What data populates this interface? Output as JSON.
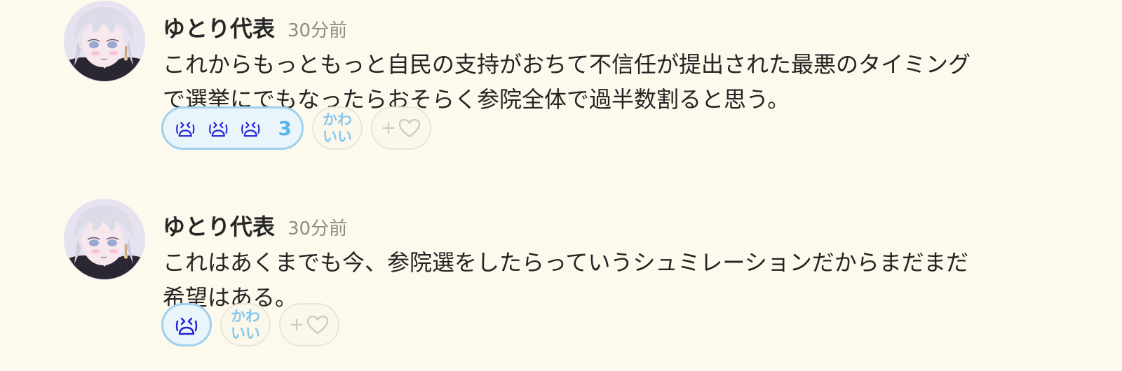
{
  "colors": {
    "background": "#fdf9ec",
    "reaction_active_bg": "#e9f4fb",
    "reaction_active_border": "#9fd0ee",
    "reaction_count": "#5bb3ea",
    "emoji_stroke": "#2020d8",
    "kawaii_text": "#86c8ef",
    "outline_chip_border": "#ece5d6"
  },
  "posts": [
    {
      "username": "ゆとり代表",
      "timestamp": "30分前",
      "lines": [
        "これからもっともっと自民の支持がおちて不信任が提出された最悪のタイミング",
        "で選挙にでもなったらおそらく参院全体で過半数割ると思う。"
      ],
      "reaction": {
        "icon": "crying-face-icon",
        "count": "3"
      },
      "kawaii": {
        "line1": "かわ",
        "line2": "いい"
      },
      "add_reaction": {
        "plus": "+",
        "icon": "heart-outline-icon"
      }
    },
    {
      "username": "ゆとり代表",
      "timestamp": "30分前",
      "lines": [
        "これはあくまでも今、参院選をしたらっていうシュミレーションだからまだまだ",
        "希望はある。"
      ],
      "reaction": {
        "icon": "crying-face-icon",
        "count": ""
      },
      "kawaii": {
        "line1": "かわ",
        "line2": "いい"
      },
      "add_reaction": {
        "plus": "+",
        "icon": "heart-outline-icon"
      }
    }
  ]
}
